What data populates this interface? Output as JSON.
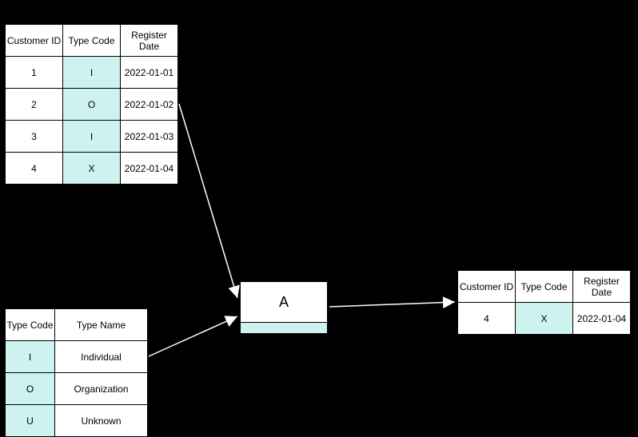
{
  "table1": {
    "headers": [
      "Customer ID",
      "Type Code",
      "Register\nDate"
    ],
    "rows": [
      {
        "id": "1",
        "code": "I",
        "date": "2022-01-01"
      },
      {
        "id": "2",
        "code": "O",
        "date": "2022-01-02"
      },
      {
        "id": "3",
        "code": "I",
        "date": "2022-01-03"
      },
      {
        "id": "4",
        "code": "X",
        "date": "2022-01-04"
      }
    ]
  },
  "table2": {
    "headers": [
      "Type Code",
      "Type Name"
    ],
    "rows": [
      {
        "code": "I",
        "name": "Individual"
      },
      {
        "code": "O",
        "name": "Organization"
      },
      {
        "code": "U",
        "name": "Unknown"
      }
    ]
  },
  "table3": {
    "headers": [
      "Customer ID",
      "Type Code",
      "Register\nDate"
    ],
    "rows": [
      {
        "id": "4",
        "code": "X",
        "date": "2022-01-04"
      }
    ]
  },
  "block": {
    "label": "A"
  }
}
